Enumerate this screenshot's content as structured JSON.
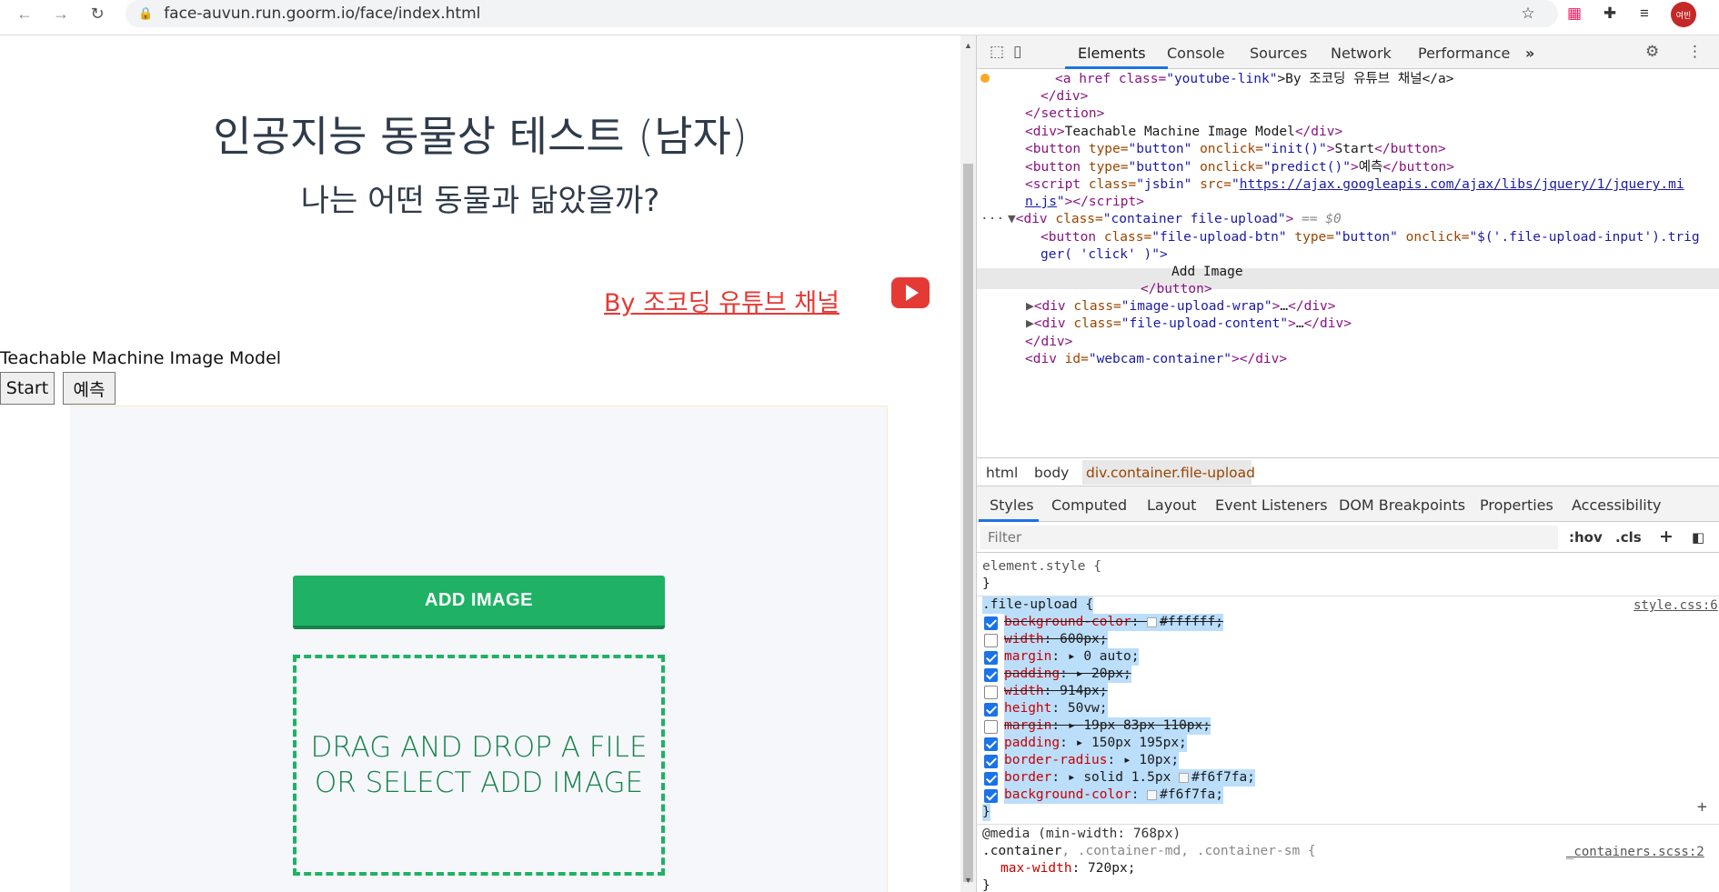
{
  "browser": {
    "url": "face-auvun.run.goorm.io/face/index.html",
    "profile_initials": "여빈"
  },
  "page": {
    "title": "인공지능 동물상 테스트 (남자)",
    "subtitle": "나는 어떤 동물과 닮았을까?",
    "youtube_link": "By 조코딩 유튜브 채널",
    "model_label": "Teachable Machine Image Model",
    "start_button": "Start",
    "predict_button": "예측",
    "add_image_button": "ADD IMAGE",
    "drop_line1": "DRAG AND DROP A FILE",
    "drop_line2": "OR SELECT ADD IMAGE"
  },
  "devtools": {
    "tabs": [
      "Elements",
      "Console",
      "Sources",
      "Network",
      "Performance"
    ],
    "more_tabs": "»",
    "tree": {
      "l1_tag_open": "<a href class=",
      "l1_val": "\"youtube-link\"",
      "l1_text": ">By 조코딩 유튜브 채널</a>",
      "l2": "</div>",
      "l3": "</section>",
      "l4_text": "Teachable Machine Image Model",
      "l5_text": "Start",
      "l6_text": "예측",
      "l7_src": "https://ajax.googleapis.com/ajax/libs/jquery/1/jquery.mi",
      "l8_src": "n.js",
      "l9_marker": "== $0",
      "l10_onclick": "\"$('.file-upload-input').trig",
      "l11": "ger( 'click' )\">",
      "l12": "Add Image",
      "l13": "</button>",
      "l14_val": "\"image-upload-wrap\"",
      "l15_val": "\"file-upload-content\"",
      "l16": "</div>",
      "l17_val": "\"webcam-container\""
    },
    "breadcrumb": [
      "html",
      "body",
      "div.container.file-upload"
    ],
    "style_tabs": [
      "Styles",
      "Computed",
      "Layout",
      "Event Listeners",
      "DOM Breakpoints",
      "Properties",
      "Accessibility"
    ],
    "filter_placeholder": "Filter",
    "filter_hov": ":hov",
    "filter_cls": ".cls",
    "element_style": "element.style {",
    "close_brace": "}",
    "rule_selector": ".file-upload {",
    "rule_source": "style.css:6",
    "props": [
      {
        "name": "background-color",
        "value": "#ffffff;",
        "checked": true,
        "struck": true,
        "swatch": "#ffffff"
      },
      {
        "name": "width",
        "value": "600px;",
        "checked": false,
        "struck": true
      },
      {
        "name": "margin",
        "value": "0 auto;",
        "checked": true,
        "struck": false,
        "arrow": true
      },
      {
        "name": "padding",
        "value": "20px;",
        "checked": true,
        "struck": true,
        "arrow": true
      },
      {
        "name": "width",
        "value": "914px;",
        "checked": false,
        "struck": true
      },
      {
        "name": "height",
        "value": "50vw;",
        "checked": true,
        "struck": false
      },
      {
        "name": "margin",
        "value": "19px 83px 110px;",
        "checked": false,
        "struck": true,
        "arrow": true
      },
      {
        "name": "padding",
        "value": "150px 195px;",
        "checked": true,
        "struck": false,
        "arrow": true
      },
      {
        "name": "border-radius",
        "value": "10px;",
        "checked": true,
        "struck": false,
        "arrow": true
      },
      {
        "name": "border",
        "value": "solid 1.5px",
        "value2": "#f6f7fa;",
        "checked": true,
        "struck": false,
        "arrow": true,
        "swatch": "#f6f7fa"
      },
      {
        "name": "background-color",
        "value": "#f6f7fa;",
        "checked": true,
        "struck": false,
        "swatch": "#f6f7fa"
      }
    ],
    "media_query": "@media (min-width: 768px)",
    "media_selector_1": ".container",
    "media_selector_2": ", .container-md, .container-sm {",
    "media_source": "_containers.scss:2",
    "media_prop": "max-width",
    "media_val": "720px;"
  },
  "colors": {
    "accent_green": "#1fb264",
    "link_red": "#e53935",
    "devtools_blue": "#1a73e8"
  }
}
